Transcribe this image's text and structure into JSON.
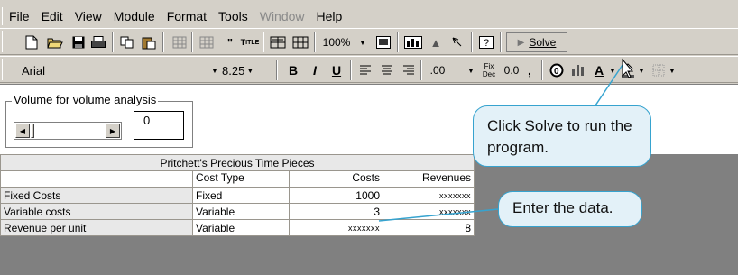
{
  "menu": [
    "File",
    "Edit",
    "View",
    "Module",
    "Format",
    "Tools",
    "Window",
    "Help"
  ],
  "menu_disabled": [
    "Window"
  ],
  "toolbar1": {
    "zoom": "100%",
    "solve_label": "Solve"
  },
  "toolbar2": {
    "font_name": "Arial",
    "font_size": "8.25",
    "bold": "B",
    "italic": "I",
    "underline": "U",
    "decimal": ".00",
    "fix_dec_top": "Fix",
    "fix_dec_bottom": "Dec",
    "zero_dec": "0.0",
    "comma": ","
  },
  "volume": {
    "group_label": "Volume for volume analysis",
    "value": "0"
  },
  "table": {
    "title": "Pritchett's Precious Time Pieces",
    "headers": [
      "",
      "Cost Type",
      "Costs",
      "Revenues"
    ],
    "rows": [
      {
        "label": "Fixed Costs",
        "type": "Fixed",
        "costs": "1000",
        "revenues": "xxxxxxx"
      },
      {
        "label": "Variable costs",
        "type": "Variable",
        "costs": "3",
        "revenues": "xxxxxxx"
      },
      {
        "label": "Revenue per unit",
        "type": "Variable",
        "costs": "xxxxxxx",
        "revenues": "8"
      }
    ]
  },
  "callouts": {
    "solve": "Click Solve to run the program.",
    "data": "Enter the data."
  },
  "colors": {
    "callout_fill": "#e3f1f8",
    "callout_border": "#36a3cf"
  }
}
